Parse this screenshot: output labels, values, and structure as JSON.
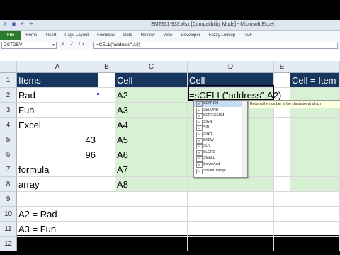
{
  "titlebar": {
    "title": "EMT931-932.xlsx [Compatibility Mode] - Microsoft Excel"
  },
  "tabs": [
    "File",
    "Home",
    "Insert",
    "Page Layout",
    "Formulas",
    "Data",
    "Review",
    "View",
    "Developer",
    "Fuzzy Lookup",
    "PDF"
  ],
  "formula_bar": {
    "name_box": "DSTDEV",
    "formula": "=CELL(\"address\",A2)",
    "icons": "✕ ✓ fx"
  },
  "columns": [
    "A",
    "B",
    "C",
    "D",
    "E"
  ],
  "rows": [
    "1",
    "2",
    "3",
    "4",
    "5",
    "6",
    "7",
    "8",
    "9",
    "10",
    "11",
    "12"
  ],
  "cells": {
    "A1": "Items",
    "A2": "Rad",
    "A3": "Fun",
    "A4": "Excel",
    "A5": "43",
    "A6": "96",
    "A7": "formula",
    "A8": "array",
    "A10": "A2 = Rad",
    "A11": "A3 = Fun",
    "A12": "A4 = Excel",
    "C1": "Cell",
    "C2": "A2",
    "C3": "A3",
    "C4": "A4",
    "C5": "A5",
    "C6": "A6",
    "C7": "A7",
    "C8": "A8",
    "D1": "Cell",
    "D2": "=sCELL(\"address\",A2)",
    "F1": "Cell = Item"
  },
  "autocomplete": {
    "items": [
      "SEARCH",
      "SECOND",
      "SERIESSUM",
      "SIGN",
      "SIN",
      "SINH",
      "SKEW",
      "SLN",
      "SLOPE",
      "SMALL",
      "SolverAdd",
      "SolverChange"
    ],
    "selected": "SEARCH",
    "tooltip": "Returns the number of the character at which"
  },
  "colors": {
    "header_fill": "#17365d",
    "green_fill": "#d8f0d4",
    "file_tab": "#2c7a2e"
  }
}
